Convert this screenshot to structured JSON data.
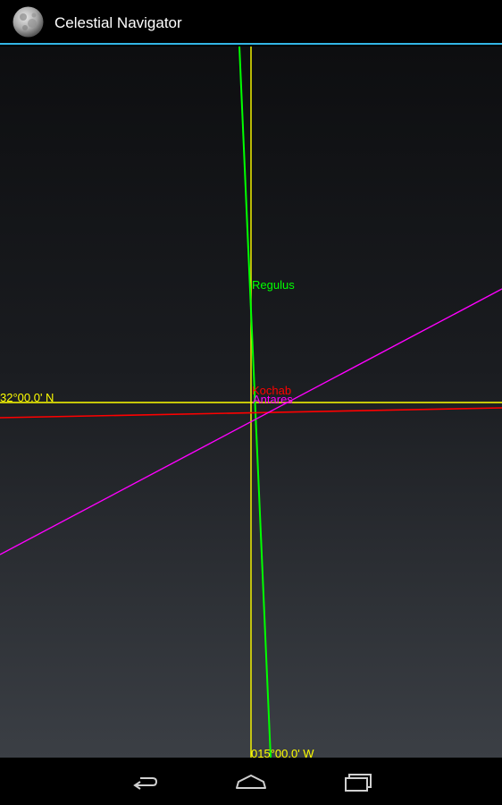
{
  "app": {
    "title": "Celestial Navigator",
    "icon": "moon-icon"
  },
  "plot": {
    "latitude_label": "32°00.0' N",
    "longitude_label": "015°00.0' W",
    "grid_color": "#ffff00",
    "lines_of_position": [
      {
        "body": "Regulus",
        "color": "#00ff00"
      },
      {
        "body": "Kochab",
        "color": "#ff0000"
      },
      {
        "body": "Antares",
        "color": "#ff00ff"
      }
    ]
  },
  "nav": {
    "back": "back-arrow-icon",
    "home": "home-icon",
    "recents": "recents-icon"
  },
  "colors": {
    "accent": "#33b5e5",
    "background_top": "#0d0e10",
    "background_bottom": "#3b3f45"
  }
}
